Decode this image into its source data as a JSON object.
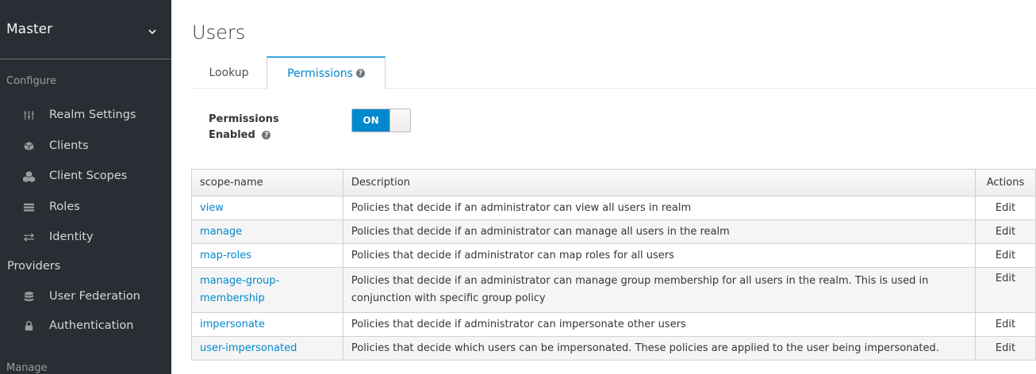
{
  "sidebar": {
    "realm": "Master",
    "configure_title": "Configure",
    "manage_title": "Manage",
    "items": [
      {
        "label": "Realm Settings",
        "icon": "sliders-icon"
      },
      {
        "label": "Clients",
        "icon": "cube-icon"
      },
      {
        "label": "Client Scopes",
        "icon": "cubes-icon"
      },
      {
        "label": "Roles",
        "icon": "list-icon"
      },
      {
        "label": "Identity",
        "icon": "exchange-icon"
      },
      {
        "label": "Providers",
        "icon": ""
      },
      {
        "label": "User Federation",
        "icon": "database-icon"
      },
      {
        "label": "Authentication",
        "icon": "lock-icon"
      }
    ]
  },
  "page": {
    "title": "Users",
    "tabs": [
      "Lookup",
      "Permissions"
    ],
    "active_tab": "Permissions"
  },
  "permissions": {
    "label_line1": "Permissions",
    "label_line2": "Enabled",
    "toggle_value": "ON"
  },
  "table": {
    "headers": [
      "scope-name",
      "Description",
      "Actions"
    ],
    "rows": [
      {
        "scope": "view",
        "description": "Policies that decide if an administrator can view all users in realm",
        "action": "Edit"
      },
      {
        "scope": "manage",
        "description": "Policies that decide if an administrator can manage all users in the realm",
        "action": "Edit"
      },
      {
        "scope": "map-roles",
        "description": "Policies that decide if administrator can map roles for all users",
        "action": "Edit"
      },
      {
        "scope_line1": "manage-group-",
        "scope_line2": "membership",
        "description_line1": "Policies that decide if an administrator can manage group membership for all users in the realm. This is used in",
        "description_line2": "conjunction with specific group policy",
        "action": "Edit"
      },
      {
        "scope": "impersonate",
        "description": "Policies that decide if administrator can impersonate other users",
        "action": "Edit"
      },
      {
        "scope": "user-impersonated",
        "description": "Policies that decide which users can be impersonated. These policies are applied to the user being impersonated.",
        "action": "Edit"
      }
    ]
  },
  "colors": {
    "sidebar_bg": "#292e34",
    "accent": "#0088ce",
    "tab_active_border": "#39a5dc"
  }
}
